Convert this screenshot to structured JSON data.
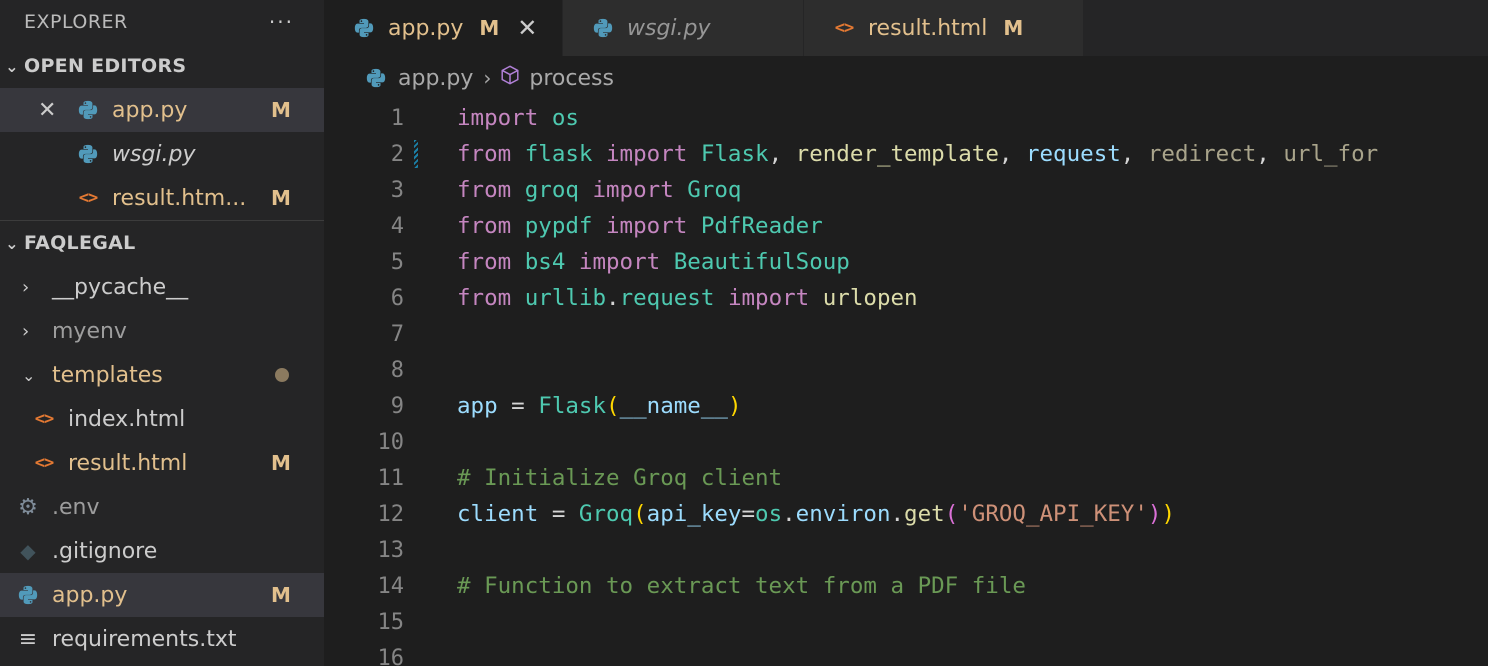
{
  "explorer": {
    "title": "EXPLORER",
    "more": "···",
    "open_editors": {
      "label": "OPEN EDITORS",
      "items": [
        {
          "name": "app.py",
          "badge": "M"
        },
        {
          "name": "wsgi.py",
          "badge": ""
        },
        {
          "name": "result.htm...",
          "badge": "M"
        }
      ]
    },
    "project": {
      "label": "FAQLEGAL",
      "items": [
        {
          "name": "__pycache__"
        },
        {
          "name": "myenv"
        },
        {
          "name": "templates"
        },
        {
          "name": "index.html"
        },
        {
          "name": "result.html",
          "badge": "M"
        },
        {
          "name": ".env"
        },
        {
          "name": ".gitignore"
        },
        {
          "name": "app.py",
          "badge": "M"
        },
        {
          "name": "requirements.txt"
        }
      ]
    }
  },
  "tabs": [
    {
      "name": "app.py",
      "badge": "M"
    },
    {
      "name": "wsgi.py"
    },
    {
      "name": "result.html",
      "badge": "M"
    }
  ],
  "breadcrumb": {
    "file": "app.py",
    "symbol": "process"
  },
  "code": {
    "line_numbers": [
      "1",
      "2",
      "3",
      "4",
      "5",
      "6",
      "7",
      "8",
      "9",
      "10",
      "11",
      "12",
      "13",
      "14",
      "15",
      "16"
    ],
    "l1": {
      "kw": "import",
      "mod": "os"
    },
    "l2": {
      "kw1": "from",
      "mod": "flask",
      "kw2": "import",
      "a": "Flask",
      "b": "render_template",
      "c": "request",
      "d": "redirect",
      "e": "url_for"
    },
    "l3": {
      "kw1": "from",
      "mod": "groq",
      "kw2": "import",
      "a": "Groq"
    },
    "l4": {
      "kw1": "from",
      "mod": "pypdf",
      "kw2": "import",
      "a": "PdfReader"
    },
    "l5": {
      "kw1": "from",
      "mod": "bs4",
      "kw2": "import",
      "a": "BeautifulSoup"
    },
    "l6": {
      "kw1": "from",
      "mod": "urllib",
      "mod2": "request",
      "kw2": "import",
      "a": "urlopen"
    },
    "l9": {
      "var": "app",
      "cls": "Flask",
      "arg": "__name__"
    },
    "l11": {
      "comment": "# Initialize Groq client"
    },
    "l12": {
      "var": "client",
      "cls": "Groq",
      "kw": "api_key",
      "mod": "os",
      "attr": "environ",
      "fn": "get",
      "str": "'GROQ_API_KEY'"
    },
    "l14": {
      "comment": "# Function to extract text from a PDF file"
    }
  }
}
